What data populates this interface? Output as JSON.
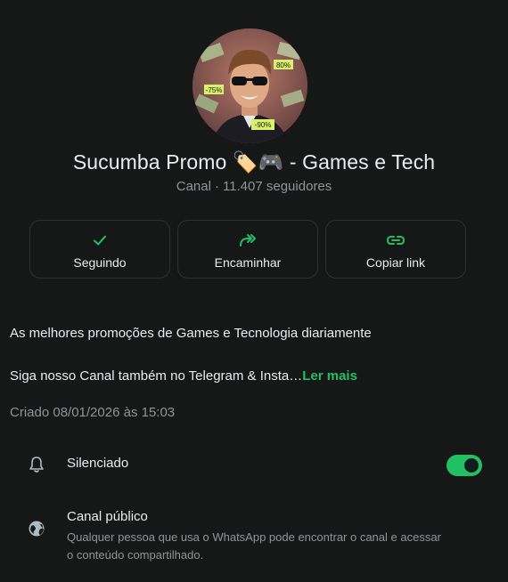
{
  "channel": {
    "name": "Sucumba Promo 🏷️🎮 - Games e Tech",
    "type": "Canal",
    "followers": "11.407 seguidores",
    "avatar_badges": [
      "80%",
      "-75%",
      "-90%"
    ]
  },
  "actions": [
    {
      "label": "Seguindo",
      "icon": "check-icon"
    },
    {
      "label": "Encaminhar",
      "icon": "forward-icon"
    },
    {
      "label": "Copiar link",
      "icon": "link-icon"
    }
  ],
  "description": {
    "line1": "As melhores promoções de Games e Tecnologia diariamente",
    "line2": "Siga nosso Canal também no Telegram & Insta…",
    "read_more": "Ler mais"
  },
  "created": "Criado 08/01/2026 às 15:03",
  "settings": {
    "mute_label": "Silenciado",
    "mute_enabled": true,
    "public_title": "Canal público",
    "public_desc": "Qualquer pessoa que usa o WhatsApp pode encontrar o canal e acessar o conteúdo compartilhado."
  },
  "colors": {
    "accent": "#21c063",
    "background": "#161717",
    "secondary_text": "#8d9599"
  }
}
